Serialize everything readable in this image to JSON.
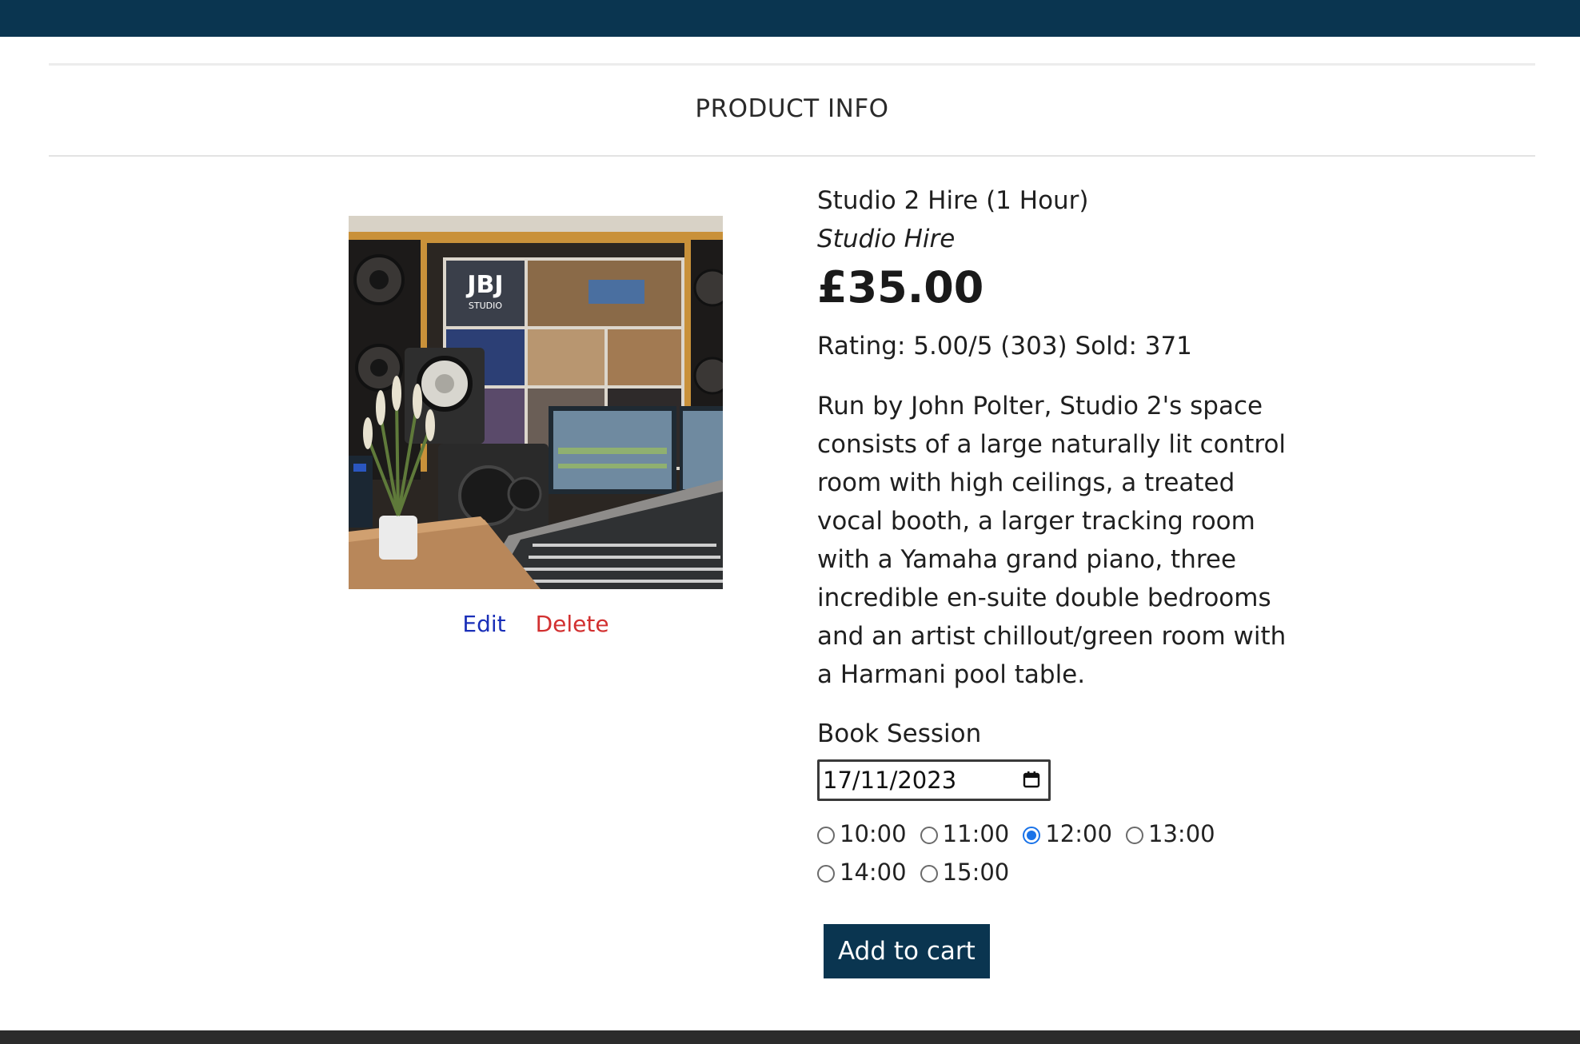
{
  "section": {
    "title": "PRODUCT INFO"
  },
  "admin": {
    "edit_label": "Edit",
    "delete_label": "Delete",
    "edit_color": "#1a2fb8",
    "delete_color": "#d23030"
  },
  "product": {
    "name": "Studio 2 Hire (1 Hour)",
    "category": "Studio Hire",
    "price": "£35.00",
    "stats": "Rating: 5.00/5 (303) Sold: 371",
    "description": "Run by John Polter, Studio 2's space consists of a large naturally lit control room with high ceilings, a treated vocal booth, a larger tracking room with a Yamaha grand piano, three incredible en-suite double bedrooms and an artist chillout/green room with a Harmani pool table.",
    "image": {
      "logo_text": "JBJ",
      "logo_sub": "STUDIO",
      "icon": "studio-photo"
    }
  },
  "booking": {
    "label": "Book Session",
    "date_value": "17/11/2023",
    "times": [
      {
        "label": "10:00",
        "selected": false
      },
      {
        "label": "11:00",
        "selected": false
      },
      {
        "label": "12:00",
        "selected": true
      },
      {
        "label": "13:00",
        "selected": false
      },
      {
        "label": "14:00",
        "selected": false
      },
      {
        "label": "15:00",
        "selected": false
      }
    ]
  },
  "cart": {
    "add_label": "Add to cart"
  },
  "colors": {
    "brand": "#0a3550",
    "footer": "#2b2b2b",
    "radio_selected": "#1a73e8"
  }
}
